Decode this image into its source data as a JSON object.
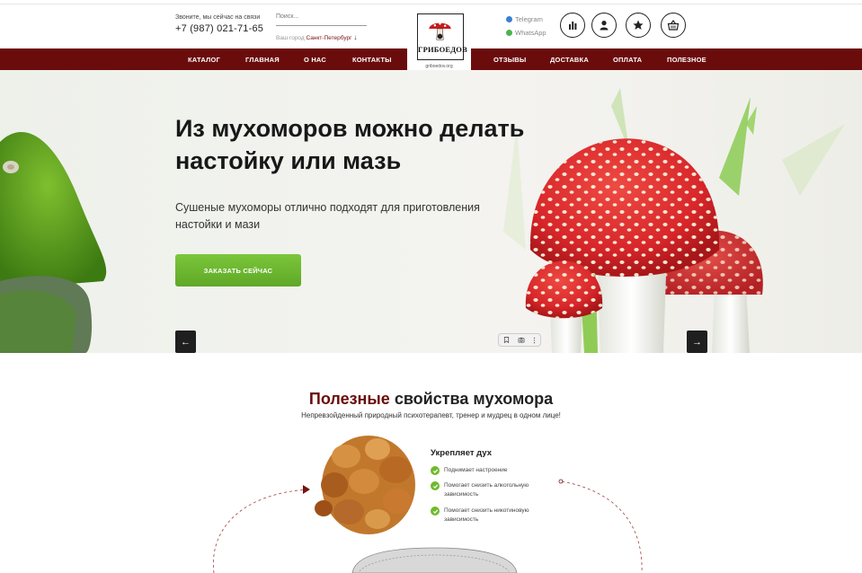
{
  "header": {
    "call_note": "Звоните, мы сейчас на связи",
    "phone": "+7 (987) 021-71-65",
    "search_placeholder": "Поиск...",
    "city_label": "Ваш город",
    "city": "Санкт-Петербург",
    "city_arrow": "↓",
    "logo_name": "ГРИБОЕДОВ",
    "logo_url": "griboedov.org",
    "telegram": "Telegram",
    "whatsapp": "WhatsApp"
  },
  "nav": {
    "items": [
      "КАТАЛОГ",
      "ГЛАВНАЯ",
      "О НАС",
      "КОНТАКТЫ",
      "ОТЗЫВЫ",
      "ДОСТАВКА",
      "ОПЛАТА",
      "ПОЛЕЗНОЕ"
    ]
  },
  "hero": {
    "title": "Из мухоморов можно делать настойку или мазь",
    "subtitle": "Сушеные мухоморы отлично подходят для приготовления настойки и мази",
    "cta": "ЗАКАЗАТЬ СЕЙЧАС",
    "prev": "←",
    "next": "→"
  },
  "section": {
    "title_accent": "Полезные",
    "title_rest": " свойства мухомора",
    "subtitle": "Непревзойденный природный психотерапевт, тренер и мудрец в одном лице!"
  },
  "benefits": {
    "title": "Укрепляет дух",
    "items": [
      "Поднимает настроение",
      "Помогает снизить алкогольную зависимость",
      "Помогает снизить никотиновую зависимость"
    ]
  },
  "colors": {
    "brand": "#6b0c0c",
    "accent_green": "#6fba2c",
    "mushroom_red": "#e0262b"
  }
}
